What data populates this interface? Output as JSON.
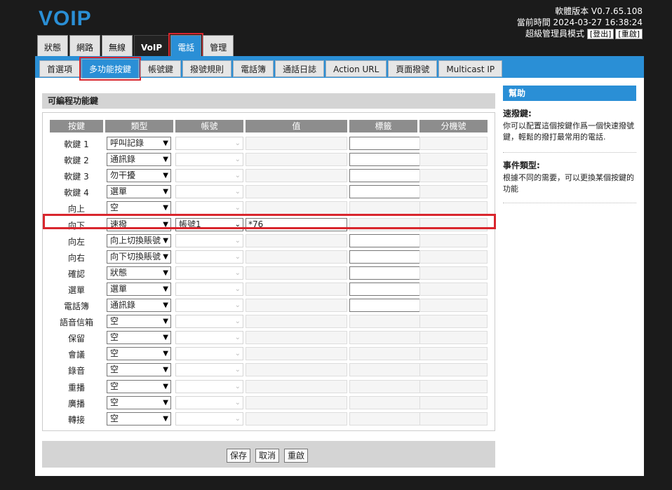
{
  "app": {
    "logo": "VOIP"
  },
  "header": {
    "version": "軟體版本 V0.7.65.108",
    "time": "當前時間 2024-03-27 16:38:24",
    "mode": "超級管理員模式",
    "logout": "[登出]",
    "restart": "[重啟]"
  },
  "main_tabs": [
    "狀態",
    "網路",
    "無線",
    "VoIP",
    "電話",
    "管理"
  ],
  "sub_tabs": [
    "首選項",
    "多功能按鍵",
    "帳號鍵",
    "撥號規則",
    "電話簿",
    "通話日誌",
    "Action URL",
    "頁面撥號",
    "Multicast IP"
  ],
  "panel": {
    "title": "可編程功能鍵"
  },
  "columns": [
    "按鍵",
    "類型",
    "帳號",
    "值",
    "標籤",
    "分機號"
  ],
  "rows": [
    {
      "key": "軟鍵 1",
      "type": "呼叫記錄",
      "account": "",
      "value": "",
      "label_active": true
    },
    {
      "key": "軟鍵 2",
      "type": "通訊錄",
      "account": "",
      "value": "",
      "label_active": true
    },
    {
      "key": "軟鍵 3",
      "type": "勿干擾",
      "account": "",
      "value": "",
      "label_active": true
    },
    {
      "key": "軟鍵 4",
      "type": "選單",
      "account": "",
      "value": "",
      "label_active": true
    },
    {
      "key": "向上",
      "type": "空",
      "account": "",
      "value": "",
      "label_active": false
    },
    {
      "key": "向下",
      "type": "速撥",
      "account": "帳號1",
      "value": "*76",
      "label_active": false
    },
    {
      "key": "向左",
      "type": "向上切換賬號",
      "account": "",
      "value": "",
      "label_active": true
    },
    {
      "key": "向右",
      "type": "向下切換賬號",
      "account": "",
      "value": "",
      "label_active": true
    },
    {
      "key": "確認",
      "type": "狀態",
      "account": "",
      "value": "",
      "label_active": true
    },
    {
      "key": "選單",
      "type": "選單",
      "account": "",
      "value": "",
      "label_active": true
    },
    {
      "key": "電話簿",
      "type": "通訊錄",
      "account": "",
      "value": "",
      "label_active": true
    },
    {
      "key": "語音信箱",
      "type": "空",
      "account": "",
      "value": "",
      "label_active": false
    },
    {
      "key": "保留",
      "type": "空",
      "account": "",
      "value": "",
      "label_active": false
    },
    {
      "key": "會議",
      "type": "空",
      "account": "",
      "value": "",
      "label_active": false
    },
    {
      "key": "錄音",
      "type": "空",
      "account": "",
      "value": "",
      "label_active": false
    },
    {
      "key": "重播",
      "type": "空",
      "account": "",
      "value": "",
      "label_active": false
    },
    {
      "key": "廣播",
      "type": "空",
      "account": "",
      "value": "",
      "label_active": false
    },
    {
      "key": "轉接",
      "type": "空",
      "account": "",
      "value": "",
      "label_active": false
    }
  ],
  "buttons": {
    "save": "保存",
    "cancel": "取消",
    "restart": "重啟"
  },
  "help": {
    "title": "幫助",
    "items": [
      {
        "title": "速撥鍵:",
        "text": "你可以配置這個按鍵作爲一個快速撥號鍵，輕鬆的撥打最常用的電話."
      },
      {
        "title": "事件類型:",
        "text": "根據不同的需要，可以更換某個按鍵的功能"
      }
    ]
  },
  "colors": {
    "accent": "#2a8fd6",
    "highlight": "#d9262d"
  }
}
